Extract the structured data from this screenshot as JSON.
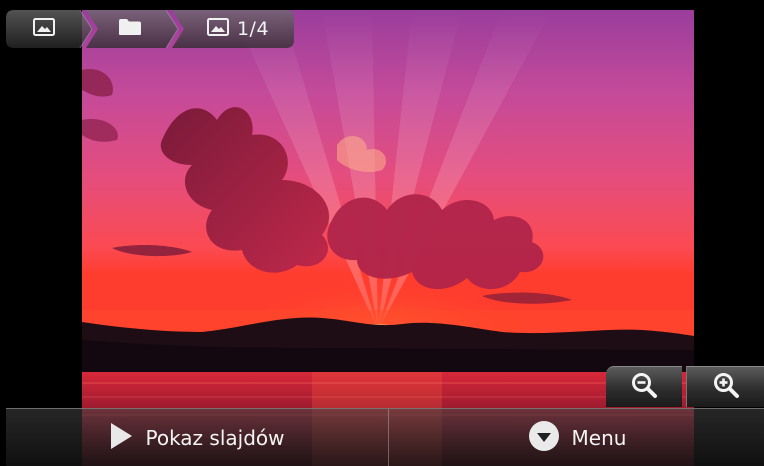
{
  "breadcrumb": {
    "items": [
      {
        "icon": "gallery-icon"
      },
      {
        "icon": "folder-icon"
      },
      {
        "icon": "picture-icon",
        "counter": "1/4"
      }
    ]
  },
  "zoom": {
    "out_icon": "zoom-out-icon",
    "in_icon": "zoom-in-icon"
  },
  "actions": {
    "slideshow_label": "Pokaz slajdów",
    "slideshow_icon": "play-icon",
    "menu_label": "Menu",
    "menu_icon": "chevron-down-circle-icon"
  },
  "colors": {
    "sky_top": "#a53f9e",
    "sky_mid": "#e8407a",
    "horizon": "#ff3a2a",
    "sun": "#ffd24a",
    "water": "#b81f33"
  }
}
